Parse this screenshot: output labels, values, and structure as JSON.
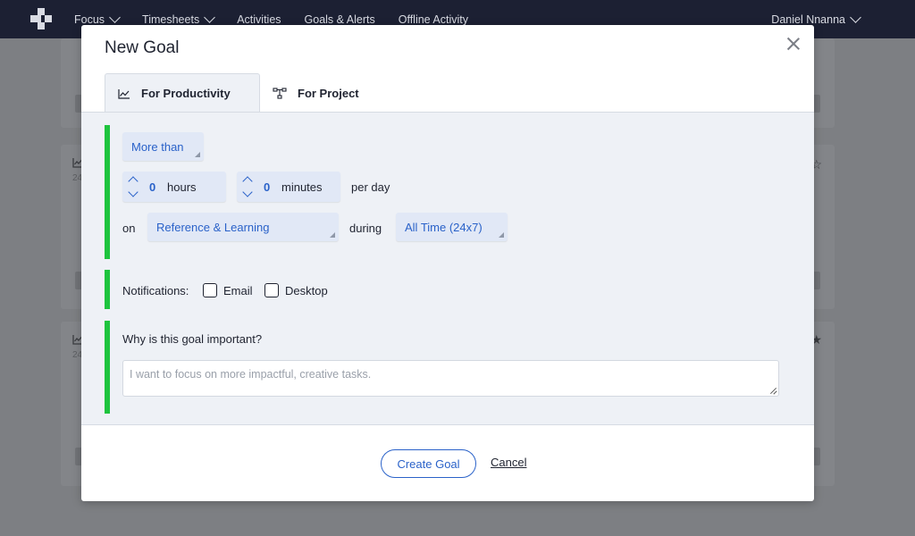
{
  "nav": {
    "items": [
      {
        "label": "Focus",
        "dropdown": true
      },
      {
        "label": "Timesheets",
        "dropdown": true
      },
      {
        "label": "Activities",
        "dropdown": false
      },
      {
        "label": "Goals & Alerts",
        "dropdown": false
      },
      {
        "label": "Offline Activity",
        "dropdown": false
      }
    ],
    "user": "Daniel Nnanna"
  },
  "background": {
    "card_subtitle_1": "24",
    "card_subtitle_2": "24"
  },
  "modal": {
    "title": "New Goal",
    "tabs": [
      {
        "label": "For Productivity",
        "icon": "line-chart-icon",
        "active": true
      },
      {
        "label": "For Project",
        "icon": "project-tree-icon",
        "active": false
      }
    ],
    "comparison": "More than",
    "hours": {
      "value": "0",
      "unit": "hours"
    },
    "minutes": {
      "value": "0",
      "unit": "minutes"
    },
    "per_day": "per day",
    "on_label": "on",
    "category": "Reference & Learning",
    "during_label": "during",
    "time_period": "All Time (24x7)",
    "notifications_label": "Notifications:",
    "email_label": "Email",
    "desktop_label": "Desktop",
    "why_label": "Why is this goal important?",
    "why_placeholder": "I want to focus on more impactful, creative tasks.",
    "create_button": "Create Goal",
    "cancel_button": "Cancel"
  },
  "colors": {
    "nav_bg": "#1c2033",
    "accent_green": "#1ec43e",
    "accent_blue": "#2a62c9",
    "panel_bg": "#eef1f6"
  }
}
